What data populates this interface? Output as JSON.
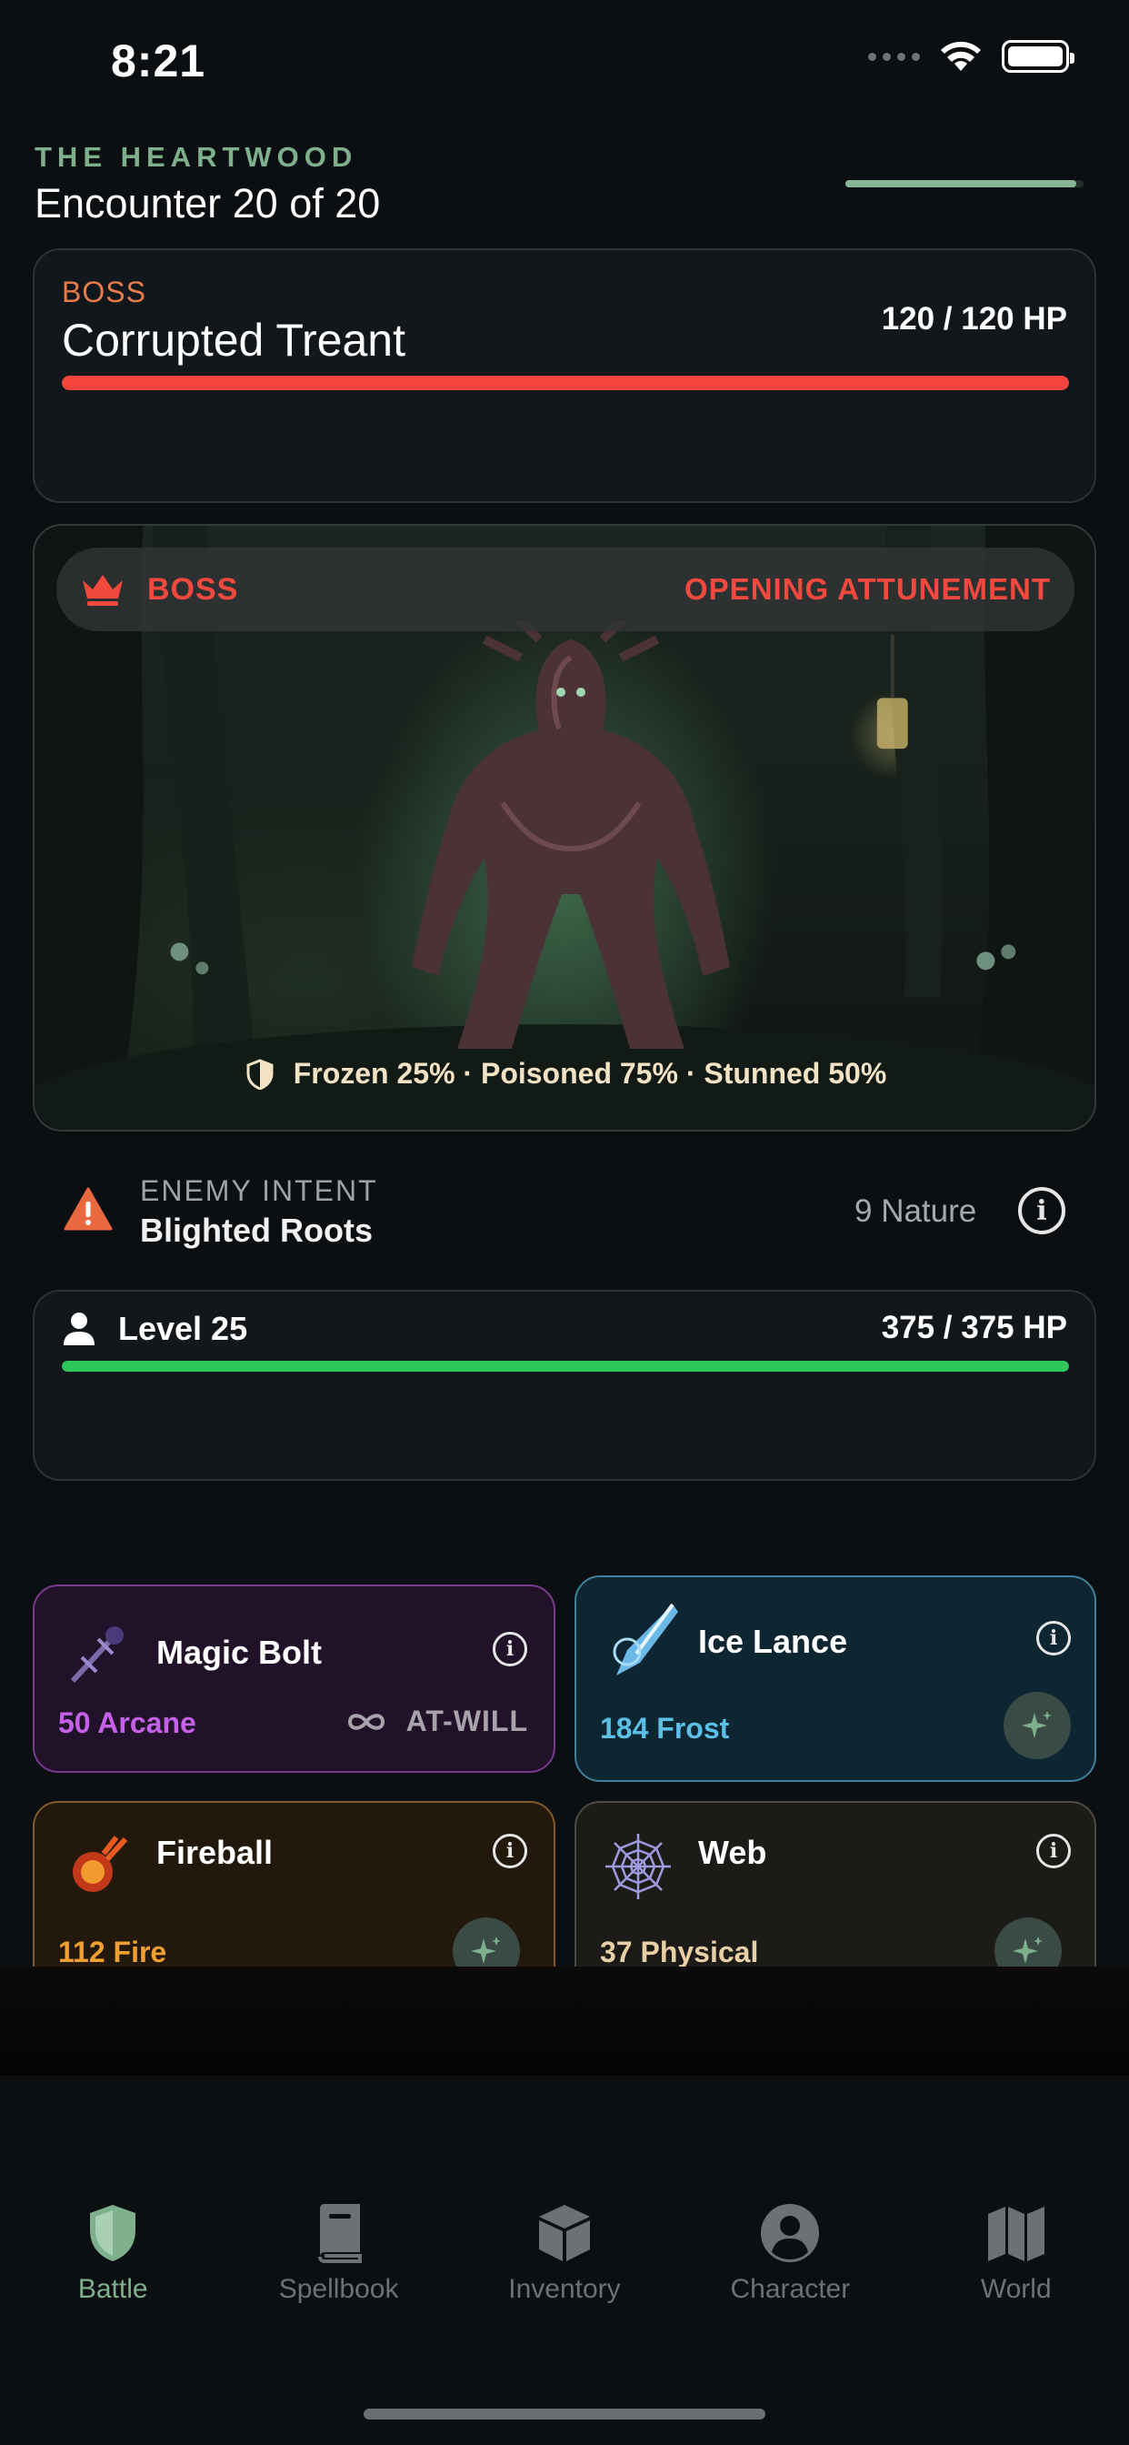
{
  "status_bar": {
    "time": "8:21",
    "icons": [
      "signal-dots-icon",
      "wifi-icon",
      "battery-icon"
    ]
  },
  "header": {
    "area": "THE HEARTWOOD",
    "encounter": "Encounter 20 of 20",
    "progress": 0.97
  },
  "boss": {
    "tag": "BOSS",
    "name": "Corrupted Treant",
    "hp_text": "120 / 120 HP",
    "hp_fraction": 1.0,
    "hp_color": "#f4463f"
  },
  "scene": {
    "banner_tag": "BOSS",
    "phase": "OPENING ATTUNEMENT",
    "effects": "Frozen 25% · Poisoned 75% · Stunned 50%"
  },
  "intent": {
    "label": "ENEMY INTENT",
    "name": "Blighted Roots",
    "value": "9 Nature"
  },
  "player": {
    "level": "Level 25",
    "hp_text": "375 / 375 HP",
    "hp_fraction": 1.0,
    "hp_color": "#2ec75c"
  },
  "spells": [
    {
      "name": "Magic Bolt",
      "damage": "50 Arcane",
      "mode": "AT-WILL",
      "color": "#c561e8"
    },
    {
      "name": "Ice Lance",
      "damage": "184 Frost",
      "color": "#5cc0e6"
    },
    {
      "name": "Fireball",
      "damage": "112 Fire",
      "color": "#f0a030"
    },
    {
      "name": "Web",
      "damage": "37 Physical",
      "color": "#e8cfa6"
    }
  ],
  "tabs": [
    {
      "label": "Battle",
      "icon": "shield-icon",
      "active": true
    },
    {
      "label": "Spellbook",
      "icon": "book-icon"
    },
    {
      "label": "Inventory",
      "icon": "box-icon"
    },
    {
      "label": "Character",
      "icon": "person-circle-icon"
    },
    {
      "label": "World",
      "icon": "map-icon"
    }
  ]
}
